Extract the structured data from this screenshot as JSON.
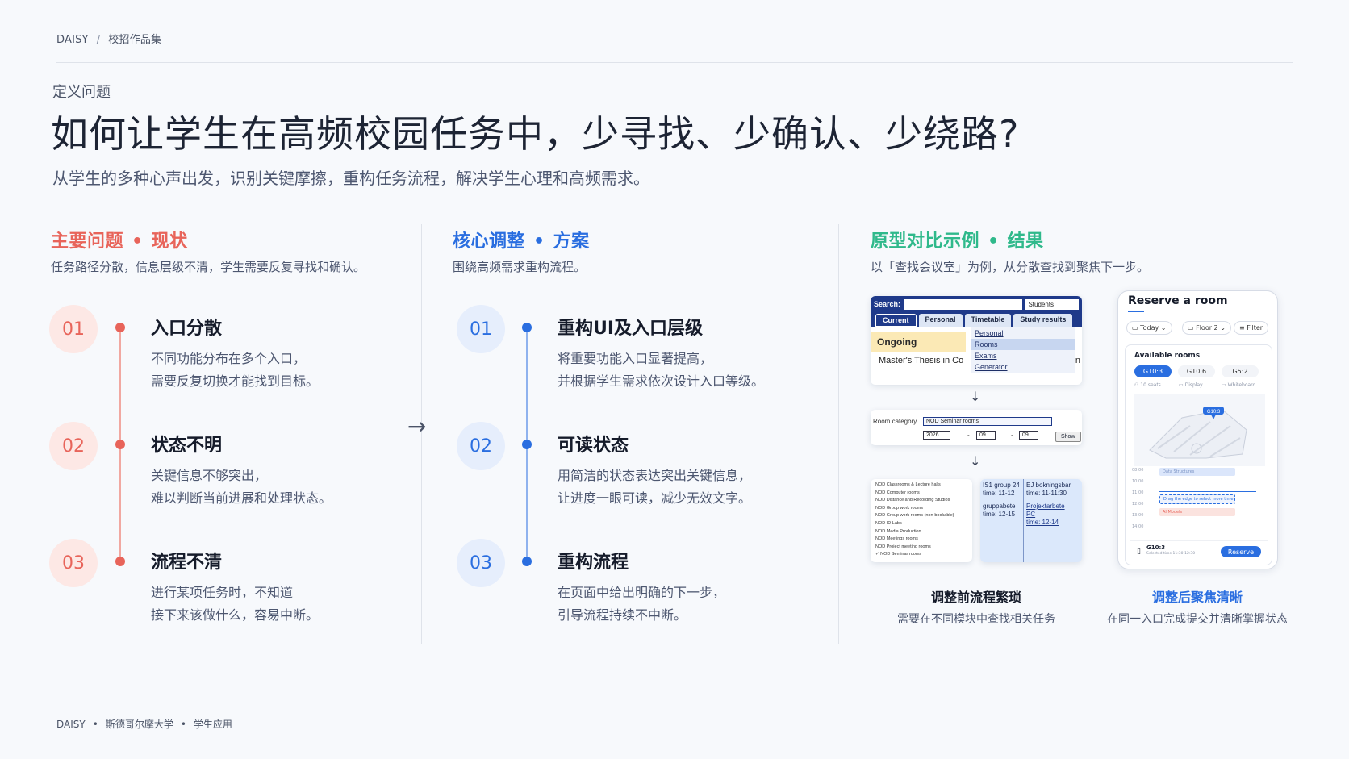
{
  "breadcrumb": {
    "brand": "DAISY",
    "separator": "/",
    "section": "校招作品集"
  },
  "header": {
    "eyebrow": "定义问题",
    "title": "如何让学生在高频校园任务中，少寻找、少确认、少绕路?",
    "subtitle": "从学生的多种心声出发，识别关键摩擦，重构任务流程，解决学生心理和高频需求。"
  },
  "columns": {
    "problems": {
      "head_a": "主要问题",
      "dot": "•",
      "head_b": "现状",
      "desc": "任务路径分散，信息层级不清，学生需要反复寻找和确认。",
      "items": [
        {
          "num": "01",
          "title": "入口分散",
          "line1": "不同功能分布在多个入口，",
          "line2": "需要反复切换才能找到目标。"
        },
        {
          "num": "02",
          "title": "状态不明",
          "line1": "关键信息不够突出，",
          "line2": "难以判断当前进展和处理状态。"
        },
        {
          "num": "03",
          "title": "流程不清",
          "line1": "进行某项任务时，不知道",
          "line2": "接下来该做什么，容易中断。"
        }
      ]
    },
    "solutions": {
      "head_a": "核心调整",
      "dot": "•",
      "head_b": "方案",
      "desc": "围绕高频需求重构流程。",
      "arrow": "→",
      "items": [
        {
          "num": "01",
          "title": "重构UI及入口层级",
          "line1": "将重要功能入口显著提高，",
          "line2": "并根据学生需求依次设计入口等级。"
        },
        {
          "num": "02",
          "title": "可读状态",
          "line1": "用简洁的状态表达突出关键信息，",
          "line2": "让进度一眼可读，减少无效文字。"
        },
        {
          "num": "03",
          "title": "重构流程",
          "line1": "在页面中给出明确的下一步，",
          "line2": "引导流程持续不中断。"
        }
      ]
    },
    "results": {
      "head_a": "原型对比示例",
      "dot": "•",
      "head_b": "结果",
      "desc": "以「查找会议室」为例，从分散查找到聚焦下一步。",
      "before": {
        "search_label": "Search:",
        "students": "Students",
        "tabs": [
          "Current",
          "Personal",
          "Timetable",
          "Study results"
        ],
        "menu": [
          "Personal",
          "Rooms",
          "Exams",
          "Generator"
        ],
        "ongoing": "Ongoing",
        "thesis": "Master's Thesis in Co",
        "thesis_tail": "n",
        "down_arrow": "↓",
        "room_category_label": "Room category",
        "room_category_value": "NOD Seminar rooms",
        "year": "2026",
        "dash1": "-",
        "month": "09",
        "dash2": "-",
        "day": "09",
        "show": "Show",
        "room_list": [
          "NOD Classrooms & Lecture halls",
          "NOD Computer rooms",
          "NOD Distance and Recording Studios",
          "NOD Group work rooms",
          "NOD Group work rooms (non-bookable)",
          "NOD ID Labs",
          "NOD Media Production",
          "NOD Meetings rooms",
          "NOD Project meeting rooms",
          "✓ NOD Seminar rooms"
        ],
        "cal_a1": "IS1 group 24",
        "cal_a2": "time: 11-12",
        "cal_a3": "gruppabete",
        "cal_a4": "time: 12-15",
        "cal_b1": "EJ bokningsbar",
        "cal_b2": "time: 11-11:30",
        "cal_b3": "Projektarbete",
        "cal_b4": "PC",
        "cal_b5": "time: 12-14",
        "caption": "调整前流程繁琐",
        "caption_desc": "需要在不同模块中查找相关任务"
      },
      "after": {
        "title": "Reserve a room",
        "filters": [
          "Today ⌄",
          "Floor 2 ⌄",
          "Filter"
        ],
        "available": "Available rooms",
        "rooms": [
          "G10:3",
          "G10:6",
          "G5:2"
        ],
        "features": [
          "10 seats",
          "Display",
          "Whiteboard"
        ],
        "map_pin": "G10:3",
        "times": [
          "08:00",
          "10:00",
          "11:00",
          "12:00",
          "13:00",
          "14:00"
        ],
        "slot_a": "Data Structures",
        "slot_b": "Drag the edge to select more time",
        "slot_c": "AI Models",
        "room_sel": "G10:3",
        "room_time": "Selected time 11:30-12:30",
        "reserve": "Reserve",
        "caption": "调整后聚焦清晰",
        "caption_desc": "在同一入口完成提交并清晰掌握状态"
      }
    }
  },
  "footer": {
    "brand": "DAISY",
    "dot": "•",
    "school": "斯德哥尔摩大学",
    "app": "学生应用"
  },
  "colors": {
    "red": "#e8645a",
    "blue": "#2a6ee0",
    "green": "#2fb98b"
  }
}
